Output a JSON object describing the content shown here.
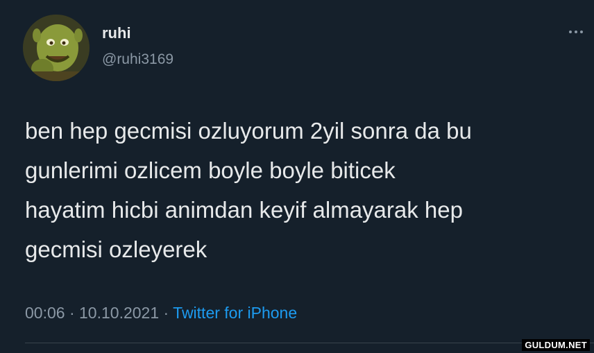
{
  "author": {
    "name": "ruhi",
    "handle": "@ruhi3169",
    "avatar_icon": "shrek-avatar"
  },
  "tweet": {
    "text": "ben hep gecmisi ozluyorum 2yil sonra da bu\ngunlerimi ozlicem boyle boyle biticek\nhayatim hicbi animdan keyif almayarak hep\ngecmisi ozleyerek",
    "time": "00:06",
    "date": "10.10.2021",
    "source": "Twitter for iPhone",
    "separator": " · "
  },
  "menu_icon": "more-horizontal-icon",
  "watermark": "GULDUM.NET",
  "colors": {
    "background": "#15202b",
    "text_primary": "#e7e9ea",
    "text_secondary": "#8b98a5",
    "link": "#1d9bf0",
    "divider": "#38444d"
  }
}
